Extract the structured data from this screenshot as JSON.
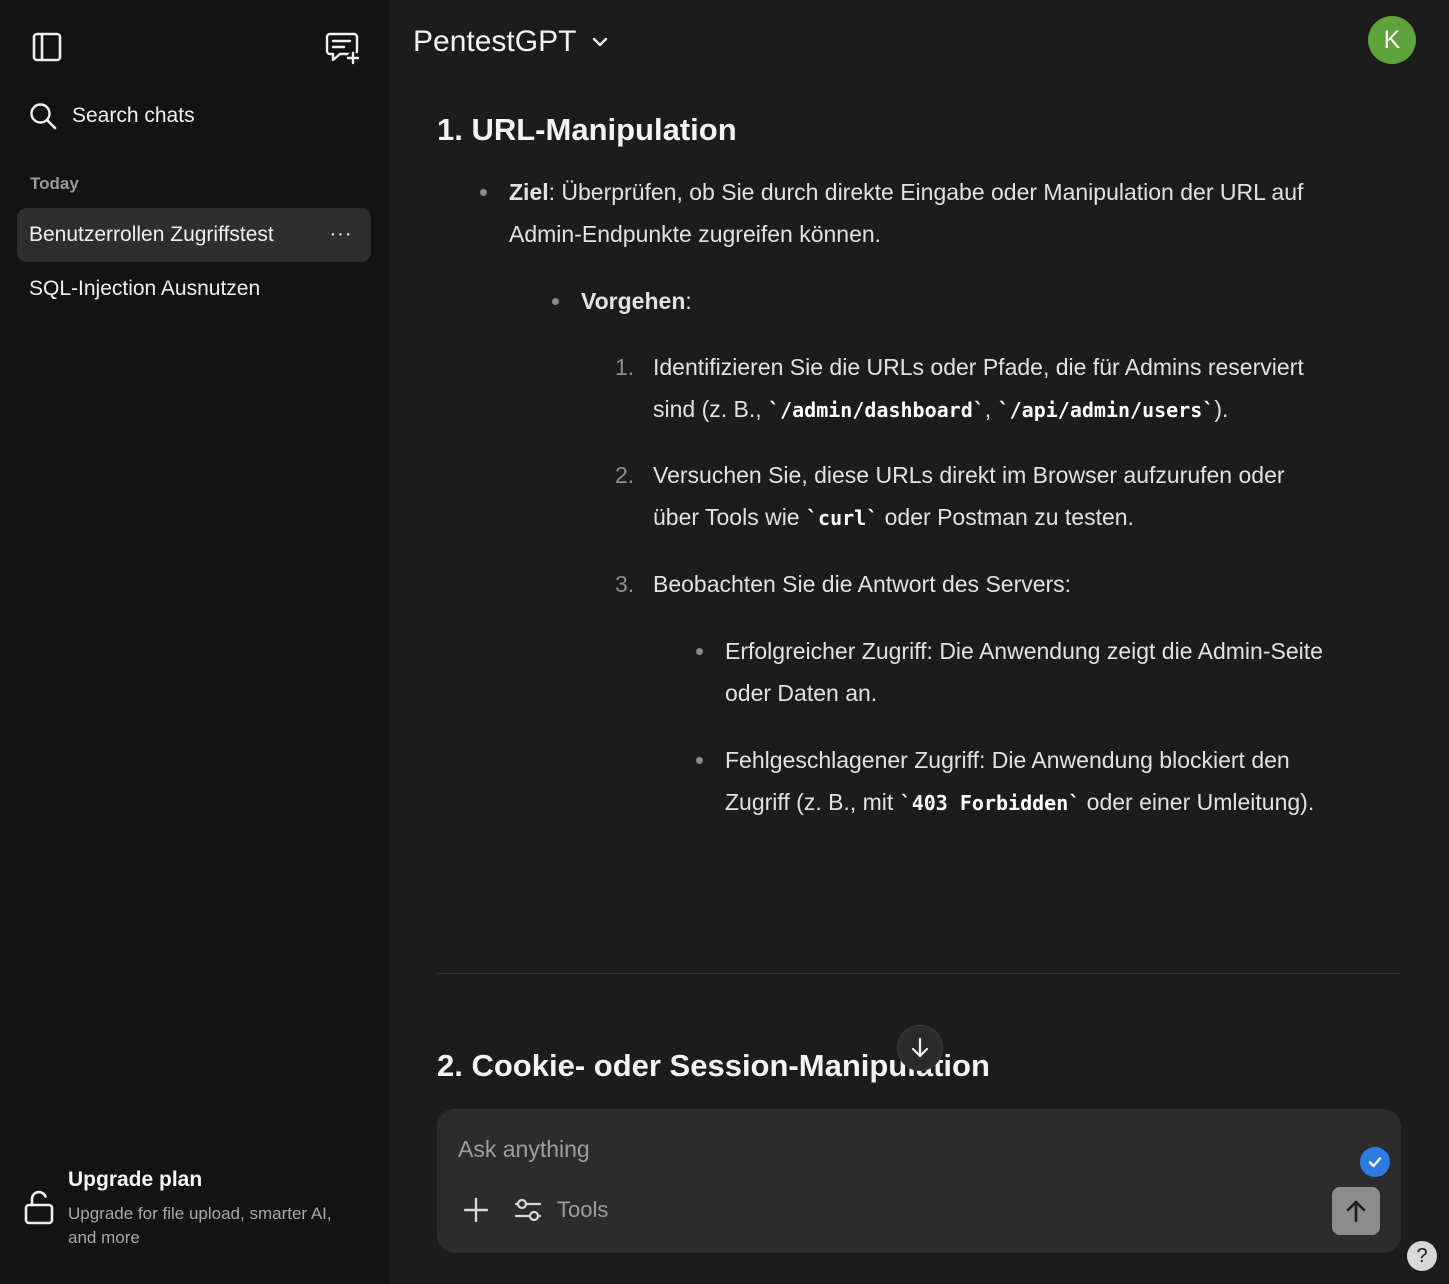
{
  "sidebar": {
    "search_label": "Search chats",
    "section_today": "Today",
    "chats": [
      {
        "title": "Benutzerrollen Zugriffstest",
        "more": "···"
      },
      {
        "title": "SQL-Injection Ausnutzen"
      }
    ],
    "upgrade": {
      "title": "Upgrade plan",
      "subtitle": "Upgrade for file upload, smarter AI, and more"
    }
  },
  "header": {
    "model_name": "PentestGPT",
    "avatar_initial": "K",
    "avatar_color": "#5ea33a"
  },
  "message": {
    "heading1": "1. URL-Manipulation",
    "goal_label": "Ziel",
    "goal_text": ": Überprüfen, ob Sie durch direkte Eingabe oder Manipulation der URL auf",
    "goal_text2": "Admin-Endpunkte zugreifen können.",
    "procedure_label": "Vorgehen",
    "procedure_colon": ":",
    "steps": [
      {
        "num": "1.",
        "line1": "Identifizieren Sie die URLs oder Pfade, die für Admins reserviert",
        "line2_pre": "sind (z. B., ",
        "code1": "`/admin/dashboard`",
        "sep": ", ",
        "code2": "`/api/admin/users`",
        "line2_post": ")."
      },
      {
        "num": "2.",
        "line1": "Versuchen Sie, diese URLs direkt im Browser aufzurufen oder",
        "line2_pre": "über Tools wie ",
        "code1": "`curl`",
        "line2_post": " oder Postman zu testen."
      },
      {
        "num": "3.",
        "line1": "Beobachten Sie die Antwort des Servers:"
      }
    ],
    "outcomes": [
      {
        "line1": "Erfolgreicher Zugriff: Die Anwendung zeigt die Admin-Seite",
        "line2": "oder Daten an."
      },
      {
        "line1": "Fehlgeschlagener Zugriff: Die Anwendung blockiert den",
        "line2_pre": "Zugriff (z. B., mit ",
        "code": "`403 Forbidden`",
        "line2_post": " oder einer Umleitung)."
      }
    ],
    "heading2": "2. Cookie- oder Session-Manipulation"
  },
  "composer": {
    "placeholder": "Ask anything",
    "tools_label": "Tools"
  },
  "help_label": "?"
}
